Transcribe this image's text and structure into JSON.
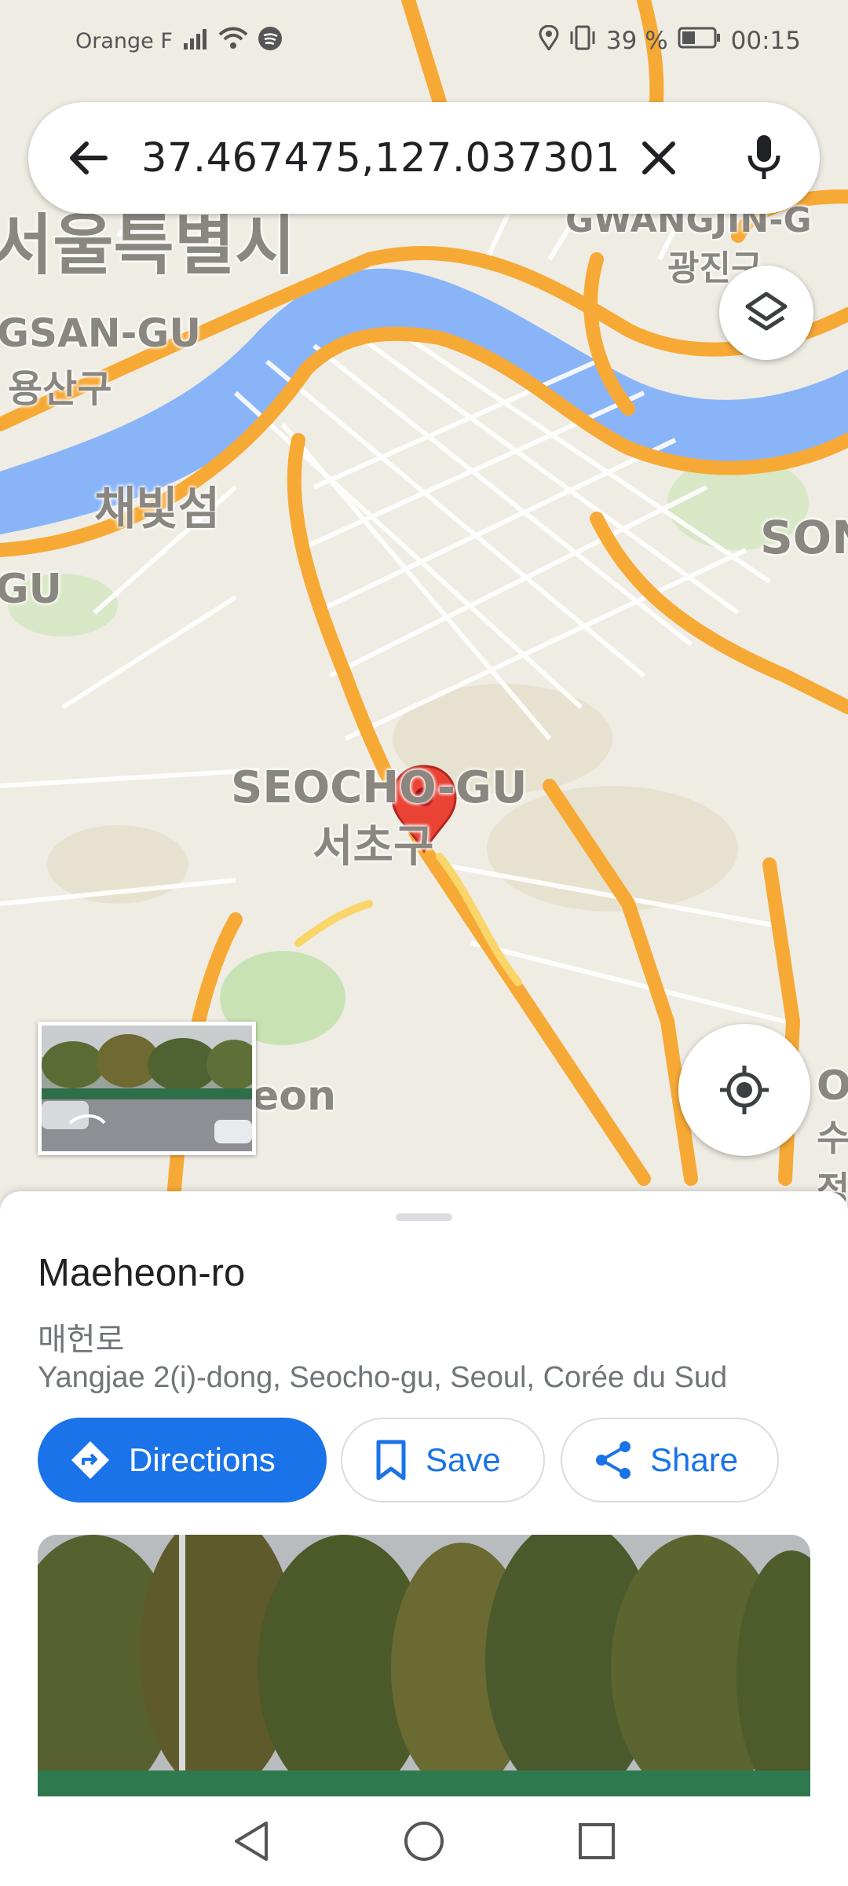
{
  "status_bar": {
    "carrier": "Orange F",
    "battery": "39 %",
    "time": "00:15"
  },
  "search": {
    "query": "37.467475,127.037301"
  },
  "map": {
    "labels": {
      "city_ko": "서울특별시",
      "gwangjin_en": "GWANGJIN-G",
      "gwangjin_ko": "광진구",
      "yongsan_en": "GSAN-GU",
      "yongsan_ko": "용산구",
      "island_ko": "채빛섬",
      "songpa_en": "SON",
      "gu_en": "GU",
      "seocho_en": "SEOCHO-GU",
      "seocho_ko": "서초구",
      "eon_en": "eon",
      "right_bottom_en": "OI",
      "right_bottom_ko": "수정"
    },
    "colors": {
      "land": "#efece4",
      "water": "#8ab4f8",
      "road_major": "#f7a935",
      "park": "#c8e2b4",
      "pin": "#ea4335"
    }
  },
  "place": {
    "title": "Maeheon-ro",
    "subtitle": "매헌로",
    "address": "Yangjae 2(i)-dong, Seocho-gu, Seoul, Corée du Sud"
  },
  "actions": {
    "directions": "Directions",
    "save": "Save",
    "share": "Share"
  },
  "icons": [
    "signal-icon",
    "wifi-icon",
    "spotify-icon",
    "location-icon",
    "vibrate-icon",
    "battery-icon",
    "back-arrow-icon",
    "close-icon",
    "mic-icon",
    "layers-icon",
    "my-location-icon",
    "directions-icon",
    "bookmark-icon",
    "share-icon",
    "nav-back-icon",
    "nav-home-icon",
    "nav-recents-icon"
  ]
}
